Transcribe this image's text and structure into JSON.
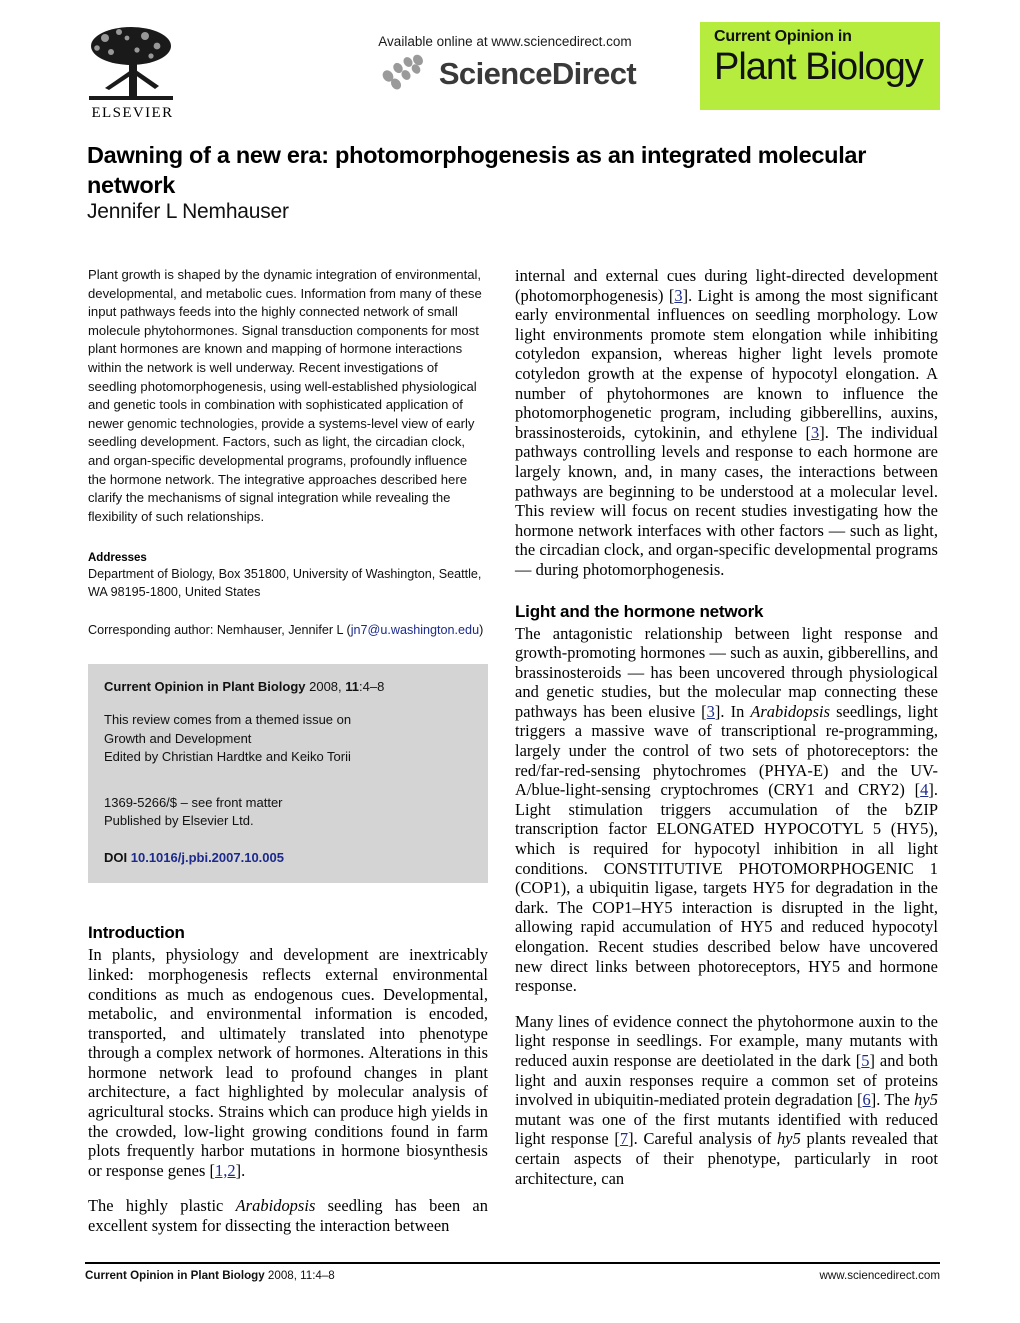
{
  "header": {
    "publisher_name": "ELSEVIER",
    "available_line": "Available online at www.sciencedirect.com",
    "sciencedirect_wordmark": "ScienceDirect",
    "banner_top": "Current Opinion in",
    "banner_main": "Plant Biology",
    "banner_color": "#b6ec3d"
  },
  "article": {
    "title": "Dawning of a new era: photomorphogenesis as an integrated molecular network",
    "author": "Jennifer L Nemhauser"
  },
  "abstract": {
    "text": "Plant growth is shaped by the dynamic integration of environmental, developmental, and metabolic cues. Information from many of these input pathways feeds into the highly connected network of small molecule phytohormones. Signal transduction components for most plant hormones are known and mapping of hormone interactions within the network is well underway. Recent investigations of seedling photomorphogenesis, using well-established physiological and genetic tools in combination with sophisticated application of newer genomic technologies, provide a systems-level view of early seedling development. Factors, such as light, the circadian clock, and organ-specific developmental programs, profoundly influence the hormone network. The integrative approaches described here clarify the mechanisms of signal integration while revealing the flexibility of such relationships."
  },
  "addresses": {
    "label": "Addresses",
    "text": "Department of Biology, Box 351800, University of Washington, Seattle, WA 98195-1800, United States",
    "corresponding_prefix": "Corresponding author: Nemhauser, Jennifer L (",
    "corresponding_email": "jn7@u.washington.edu",
    "corresponding_suffix": ")"
  },
  "citation_box": {
    "journal": "Current Opinion in Plant Biology",
    "year_vol": " 2008, ",
    "volume": "11",
    "pages": ":4–8",
    "themed_line1": "This review comes from a themed issue on",
    "themed_line2": "Growth and Development",
    "edited_by": "Edited by Christian Hardtke and Keiko Torii",
    "front_matter": "1369-5266/$ – see front matter",
    "published_by": "Published by Elsevier Ltd.",
    "doi_label": "DOI",
    "doi_value": "10.1016/j.pbi.2007.10.005"
  },
  "left_column": {
    "intro_heading": "Introduction",
    "intro_p1_a": "In plants, physiology and development are inextricably linked: morphogenesis reflects external environmental conditions as much as endogenous cues. Developmental, metabolic, and environmental information is encoded, transported, and ultimately translated into phenotype through a complex network of hormones. Alterations in this hormone network lead to profound changes in plant architecture, a fact highlighted by molecular analysis of agricultural stocks. Strains which can produce high yields in the crowded, low-light growing conditions found in farm plots frequently harbor mutations in hormone biosynthesis or response genes [",
    "intro_p1_cite": "1,2",
    "intro_p1_b": "].",
    "intro_p2_a": "The highly plastic ",
    "intro_p2_italic": "Arabidopsis",
    "intro_p2_b": " seedling has been an excellent system for dissecting the interaction between"
  },
  "right_column": {
    "p1_a": "internal and external cues during light-directed development (photomorphogenesis) [",
    "p1_cite1": "3",
    "p1_b": "]. Light is among the most significant early environmental influences on seedling morphology. Low light environments promote stem elongation while inhibiting cotyledon expansion, whereas higher light levels promote cotyledon growth at the expense of hypocotyl elongation. A number of phytohormones are known to influence the photomorphogenetic program, including gibberellins, auxins, brassinosteroids, cytokinin, and ethylene [",
    "p1_cite2": "3",
    "p1_c": "]. The individual pathways controlling levels and response to each hormone are largely known, and, in many cases, the interactions between pathways are beginning to be understood at a molecular level. This review will focus on recent studies investigating how the hormone network interfaces with other factors — such as light, the circadian clock, and organ-specific developmental programs — during photomorphogenesis.",
    "section_heading": "Light and the hormone network",
    "p2_a": "The antagonistic relationship between light response and growth-promoting hormones — such as auxin, gibberellins, and brassinosteroids — has been uncovered through physiological and genetic studies, but the molecular map connecting these pathways has been elusive [",
    "p2_cite1": "3",
    "p2_b": "]. In ",
    "p2_italic1": "Arabidopsis",
    "p2_c": " seedlings, light triggers a massive wave of transcriptional re-programming, largely under the control of two sets of photoreceptors: the red/far-red-sensing phytochromes (PHYA-E) and the UV-A/blue-light-sensing cryptochromes (CRY1 and CRY2) [",
    "p2_cite2": "4",
    "p2_d": "]. Light stimulation triggers accumulation of the bZIP transcription factor ELONGATED HYPOCOTYL 5 (HY5), which is required for hypocotyl inhibition in all light conditions. CONSTITUTIVE PHOTOMORPHOGENIC 1 (COP1), a ubiquitin ligase, targets HY5 for degradation in the dark. The COP1–HY5 interaction is disrupted in the light, allowing rapid accumulation of HY5 and reduced hypocotyl elongation. Recent studies described below have uncovered new direct links between photoreceptors, HY5 and hormone response.",
    "p3_a": "Many lines of evidence connect the phytohormone auxin to the light response in seedlings. For example, many mutants with reduced auxin response are deetiolated in the dark [",
    "p3_cite1": "5",
    "p3_b": "] and both light and auxin responses require a common set of proteins involved in ubiquitin-mediated protein degradation [",
    "p3_cite2": "6",
    "p3_c": "]. The ",
    "p3_italic1": "hy5",
    "p3_d": " mutant was one of the first mutants identified with reduced light response [",
    "p3_cite3": "7",
    "p3_e": "]. Careful analysis of ",
    "p3_italic2": "hy5",
    "p3_f": " plants revealed that certain aspects of their phenotype, particularly in root architecture, can"
  },
  "footer": {
    "journal": "Current Opinion in Plant Biology",
    "ref": " 2008, 11:4–8",
    "website": "www.sciencedirect.com"
  }
}
